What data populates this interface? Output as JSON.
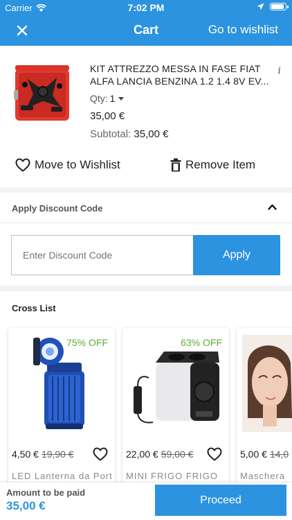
{
  "status_bar": {
    "carrier": "Carrier",
    "time": "7:02 PM",
    "battery_level": 0.9
  },
  "nav": {
    "title": "Cart",
    "wishlist_link": "Go to wishlist"
  },
  "cart_item": {
    "name_line1": "KIT ATTREZZO MESSA IN FASE FIAT",
    "name_line2": "ALFA LANCIA BENZINA 1.2 1.4 8V EV...",
    "info_icon": "i",
    "qty_label": "Qty:",
    "qty_value": "1",
    "price": "35,00 €",
    "subtotal_label": "Subtotal:",
    "subtotal_value": "35,00 €",
    "move_to_wishlist": "Move to Wishlist",
    "remove_item": "Remove Item"
  },
  "discount": {
    "header": "Apply Discount Code",
    "placeholder": "Enter Discount Code",
    "apply_label": "Apply"
  },
  "cross_list": {
    "title": "Cross List",
    "items": [
      {
        "discount": "75% OFF",
        "price": "4,50 €",
        "old_price": "19,90 €",
        "name": "LED Lanterna da Port"
      },
      {
        "discount": "63% OFF",
        "price": "22,00 €",
        "old_price": "59,00 €",
        "name": "MINI FRIGO FRIGO"
      },
      {
        "discount": "",
        "price": "5,00 €",
        "old_price": "14,0",
        "name": "Maschera"
      }
    ]
  },
  "footer": {
    "amount_label": "Amount to be paid",
    "amount_value": "35,00 €",
    "proceed_label": "Proceed"
  },
  "colors": {
    "primary": "#2b93df",
    "discount_green": "#58b033"
  }
}
